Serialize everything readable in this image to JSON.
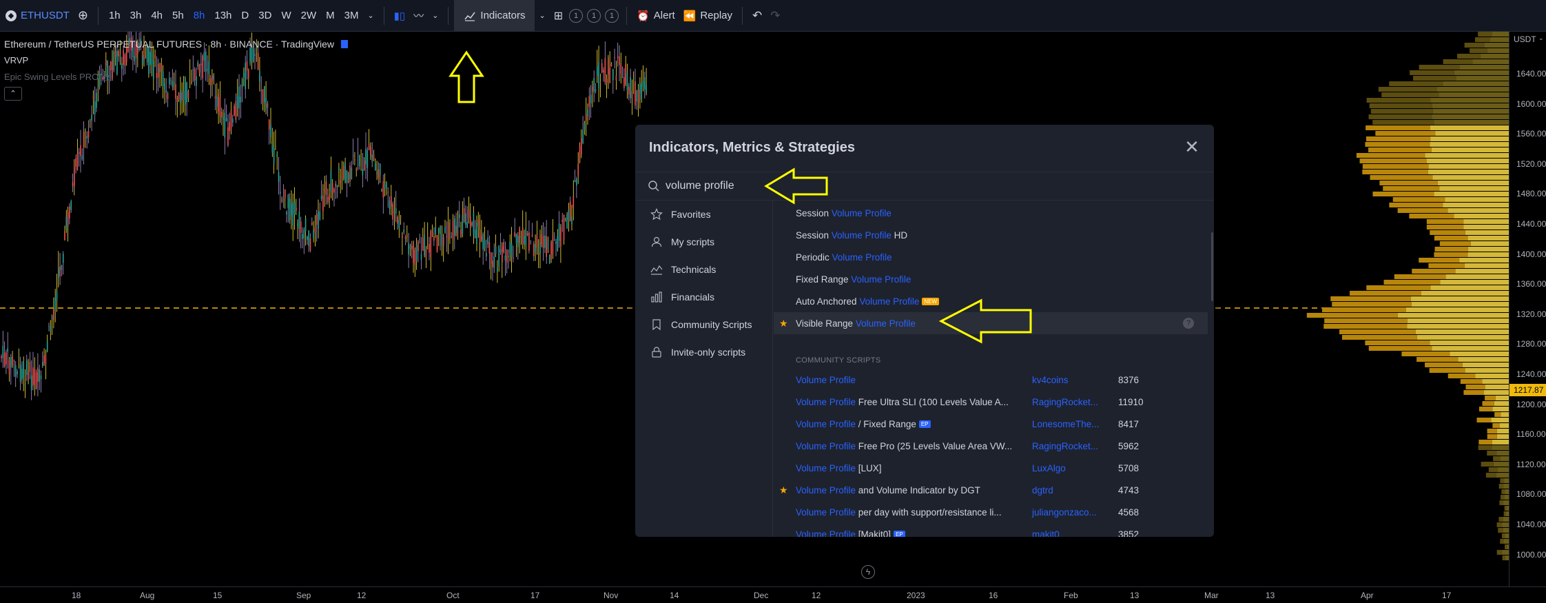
{
  "toolbar": {
    "symbol": "ETHUSDT",
    "timeframes": [
      "1h",
      "3h",
      "4h",
      "5h",
      "8h",
      "13h",
      "D",
      "3D",
      "W",
      "2W",
      "M",
      "3M"
    ],
    "active_timeframe": "8h",
    "indicators_label": "Indicators",
    "template_counts": [
      "1",
      "1",
      "1"
    ],
    "alert_label": "Alert",
    "replay_label": "Replay"
  },
  "legend": {
    "title": "Ethereum / TetherUS PERPETUAL FUTURES · 8h · BINANCE · TradingView",
    "vrvp": "VRVP",
    "epic": "Epic Swing Levels PRO"
  },
  "price_axis": {
    "currency": "USDT",
    "labels": [
      "1640.00",
      "1600.00",
      "1560.00",
      "1520.00",
      "1480.00",
      "1440.00",
      "1400.00",
      "1360.00",
      "1320.00",
      "1280.00",
      "1240.00",
      "1200.00",
      "1160.00",
      "1120.00",
      "1080.00",
      "1040.00",
      "1000.00"
    ],
    "current_price": "1217.87"
  },
  "time_axis": {
    "labels": [
      "18",
      "Aug",
      "15",
      "Sep",
      "12",
      "Oct",
      "17",
      "Nov",
      "14",
      "Dec",
      "12",
      "2023",
      "16",
      "Feb",
      "13",
      "Mar",
      "13",
      "Apr",
      "17"
    ]
  },
  "dialog": {
    "title": "Indicators, Metrics & Strategies",
    "search_value": "volume profile",
    "sidebar": [
      "Favorites",
      "My scripts",
      "Technicals",
      "Financials",
      "Community Scripts",
      "Invite-only scripts"
    ],
    "builtin": [
      {
        "pre": "Session ",
        "hl": "Volume Profile",
        "post": ""
      },
      {
        "pre": "Session ",
        "hl": "Volume Profile",
        "post": " HD"
      },
      {
        "pre": "Periodic ",
        "hl": "Volume Profile",
        "post": ""
      },
      {
        "pre": "Fixed Range ",
        "hl": "Volume Profile",
        "post": ""
      },
      {
        "pre": "Auto Anchored ",
        "hl": "Volume Profile",
        "post": "",
        "badge": "NEW"
      },
      {
        "pre": "Visible Range ",
        "hl": "Volume Profile",
        "post": "",
        "star": true,
        "selected": true
      }
    ],
    "community_header": "COMMUNITY SCRIPTS",
    "community": [
      {
        "hl": "Volume Profile",
        "post": "",
        "author": "kv4coins",
        "likes": "8376"
      },
      {
        "hl": "Volume Profile",
        "post": " Free Ultra SLI (100 Levels Value A...",
        "author": "RagingRocket...",
        "likes": "11910"
      },
      {
        "hl": "Volume Profile",
        "post": " / Fixed Range",
        "badge": "EP",
        "author": "LonesomeThe...",
        "likes": "8417"
      },
      {
        "hl": "Volume Profile",
        "post": " Free Pro (25 Levels Value Area VW...",
        "author": "RagingRocket...",
        "likes": "5962"
      },
      {
        "hl": "Volume Profile",
        "post": " [LUX]",
        "author": "LuxAlgo",
        "likes": "5708"
      },
      {
        "hl": "Volume Profile",
        "post": " and Volume Indicator by DGT",
        "author": "dgtrd",
        "likes": "4743",
        "star": true
      },
      {
        "hl": "Volume Profile",
        "post": " per day with support/resistance li...",
        "author": "juliangonzaco...",
        "likes": "4568"
      },
      {
        "hl": "Volume Profile",
        "post": " [Makit0]",
        "badge": "EP",
        "author": "makit0",
        "likes": "3852"
      }
    ]
  },
  "colors": {
    "accent": "#2962ff",
    "highlight": "#f0b90b",
    "annotation": "#ffff00",
    "up": "#26a69a",
    "down": "#ef5350"
  }
}
